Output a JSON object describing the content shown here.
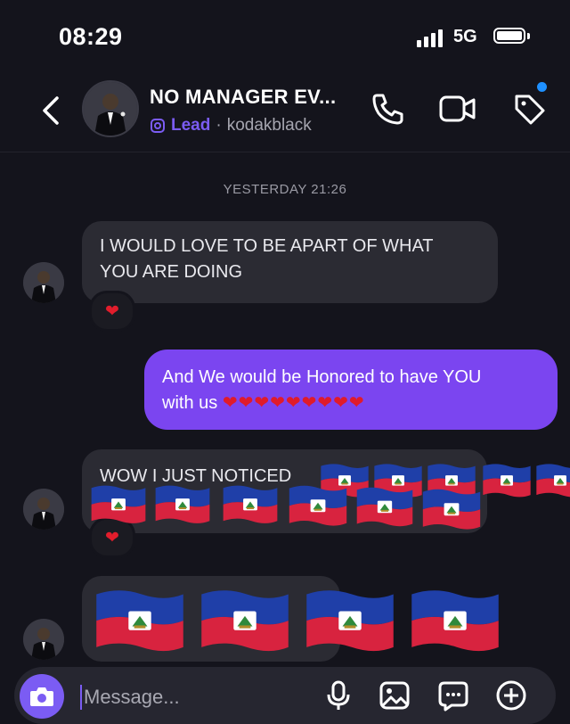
{
  "status": {
    "time": "08:29",
    "network": "5G"
  },
  "header": {
    "title": "NO MANAGER EV...",
    "badge": "Lead",
    "separator": "·",
    "username": "kodakblack"
  },
  "timestamp": "YESTERDAY 21:26",
  "messages": [
    {
      "direction": "incoming",
      "lines": [
        "I WOULD LOVE TO BE APART OF WHAT",
        "YOU ARE DOING"
      ],
      "reaction": "❤"
    },
    {
      "direction": "outgoing",
      "lines": [
        "And We would be Honored to have YOU",
        "with us"
      ],
      "emoji": "❤❤❤❤❤❤❤❤❤"
    },
    {
      "direction": "incoming",
      "lines": [
        "WOW I JUST NOTICED"
      ],
      "reaction": "❤"
    },
    {
      "direction": "incoming",
      "lines": [
        ""
      ]
    }
  ],
  "compose": {
    "placeholder": "Message..."
  },
  "colors": {
    "accent": "#7b5cf3",
    "outgoing_bubble": "#7b45f0",
    "incoming_bubble": "#2b2b33",
    "background": "#14141c",
    "notification": "#1e90ff"
  }
}
